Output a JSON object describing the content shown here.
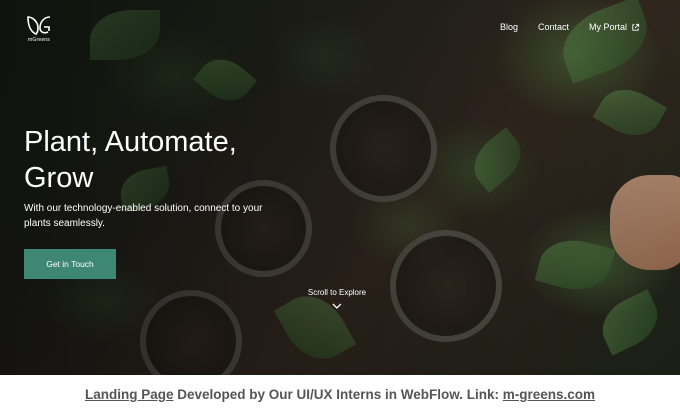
{
  "brand": {
    "logo_text": "mGreens"
  },
  "nav": {
    "items": [
      {
        "label": "Blog"
      },
      {
        "label": "Contact"
      },
      {
        "label": "My Portal",
        "icon": "external-link-icon"
      }
    ]
  },
  "hero": {
    "headline": "Plant, Automate, Grow",
    "subtext": "With our technology-enabled solution, connect to your plants seamlessly.",
    "cta_label": "Get in Touch",
    "scroll_label": "Scroll to Explore",
    "scroll_icon": "chevron-down-icon"
  },
  "caption": {
    "link1": "Landing Page",
    "middle": " Developed by Our UI/UX Interns in WebFlow. Link: ",
    "link2": "m-greens.com"
  },
  "colors": {
    "accent": "#3f8775",
    "caption_text": "#555555",
    "hero_text": "#ffffff"
  }
}
